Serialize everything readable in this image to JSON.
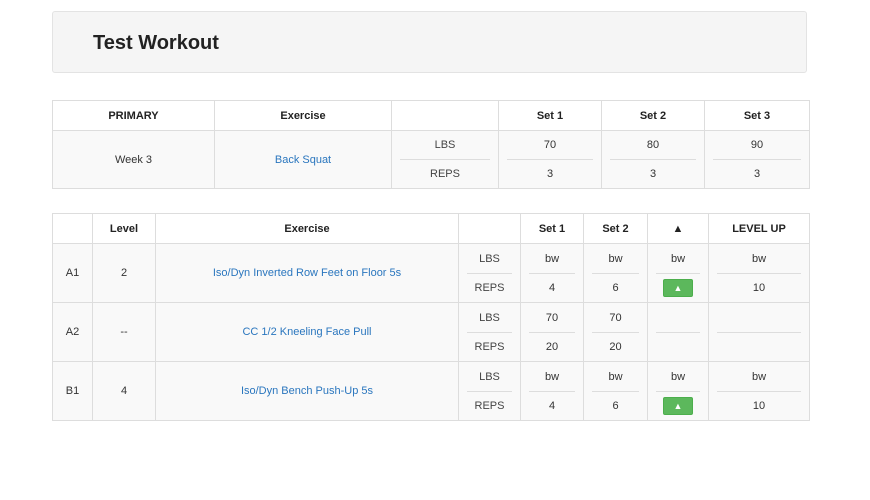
{
  "title": "Test Workout",
  "primary": {
    "headers": [
      "PRIMARY",
      "Exercise",
      "",
      "Set 1",
      "Set 2",
      "Set 3"
    ],
    "row": {
      "week": "Week 3",
      "exercise": "Back Squat",
      "lbs_label": "LBS",
      "reps_label": "REPS",
      "lbs": [
        "70",
        "80",
        "90"
      ],
      "reps": [
        "3",
        "3",
        "3"
      ]
    }
  },
  "accessory": {
    "headers": [
      "",
      "Level",
      "Exercise",
      "",
      "Set 1",
      "Set 2",
      "▲",
      "LEVEL UP"
    ],
    "lbs_label": "LBS",
    "reps_label": "REPS",
    "up_button": "▲",
    "rows": [
      {
        "id": "A1",
        "level": "2",
        "exercise": "Iso/Dyn Inverted Row Feet on Floor 5s",
        "lbs": [
          "bw",
          "bw",
          "bw",
          "bw"
        ],
        "reps": [
          "4",
          "6",
          "▲",
          "10"
        ]
      },
      {
        "id": "A2",
        "level": "--",
        "exercise": "CC 1/2 Kneeling Face Pull",
        "lbs": [
          "70",
          "70",
          "",
          ""
        ],
        "reps": [
          "20",
          "20",
          "",
          ""
        ]
      },
      {
        "id": "B1",
        "level": "4",
        "exercise": "Iso/Dyn Bench Push-Up 5s",
        "lbs": [
          "bw",
          "bw",
          "bw",
          "bw"
        ],
        "reps": [
          "4",
          "6",
          "▲",
          "10"
        ]
      }
    ]
  }
}
